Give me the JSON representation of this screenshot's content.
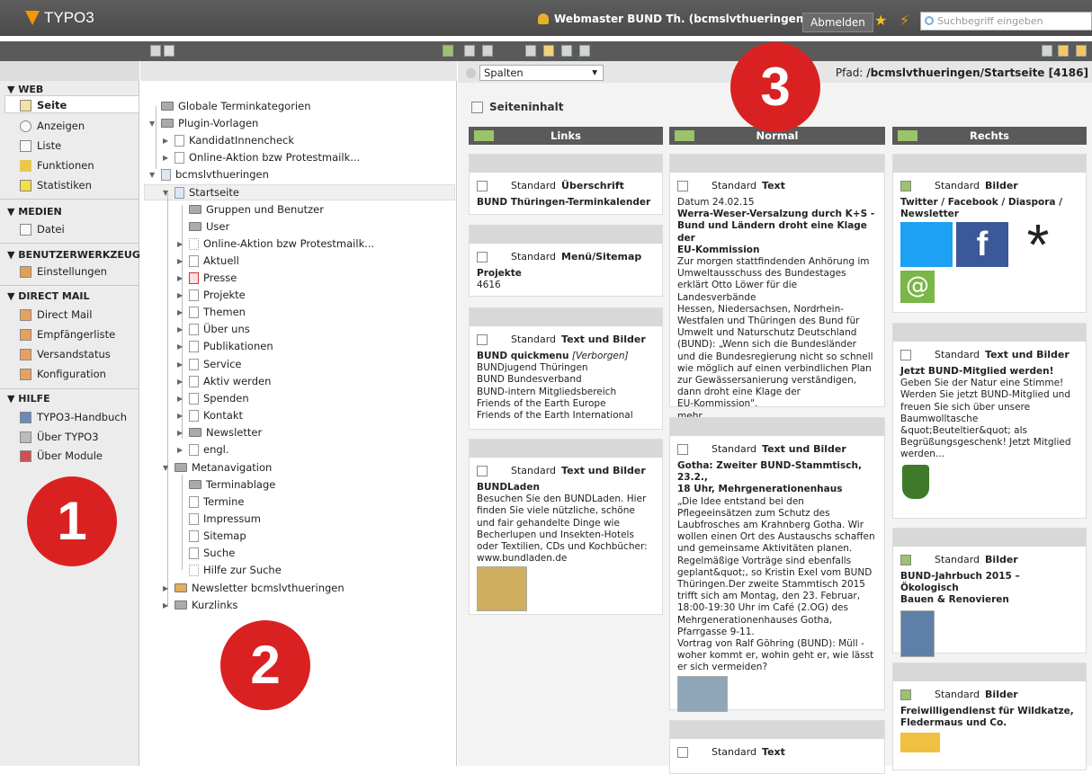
{
  "topbar": {
    "app_name": "TYPO3",
    "user": "Webmaster BUND Th. (bcmslvthueringen)",
    "logout": "Abmelden",
    "search_placeholder": "Suchbegriff eingeben"
  },
  "modules": {
    "web_label": "▼ WEB",
    "web_items": [
      "Seite",
      "Anzeigen",
      "Liste",
      "Funktionen",
      "Statistiken"
    ],
    "medien_label": "▼ MEDIEN",
    "medien_items": [
      "Datei"
    ],
    "tools_label": "▼ BENUTZERWERKZEUGE",
    "tools_items": [
      "Einstellungen"
    ],
    "dm_label": "▼ DIRECT MAIL",
    "dm_items": [
      "Direct Mail",
      "Empfängerliste",
      "Versandstatus",
      "Konfiguration"
    ],
    "help_label": "▼ HILFE",
    "help_items": [
      "TYPO3-Handbuch",
      "Über TYPO3",
      "Über Module"
    ]
  },
  "tree": [
    "Globale Terminkategorien",
    "Plugin-Vorlagen",
    "KandidatInnencheck",
    "Online-Aktion bzw Protestmailk...",
    "bcmslvthueringen",
    "Startseite",
    "Gruppen und Benutzer",
    "User",
    "Online-Aktion bzw Protestmailk...",
    "Aktuell",
    "Presse",
    "Projekte",
    "Themen",
    "Über uns",
    "Publikationen",
    "Service",
    "Aktiv werden",
    "Spenden",
    "Kontakt",
    "Newsletter",
    "engl.",
    "Metanavigation",
    "Terminablage",
    "Termine",
    "Impressum",
    "Sitemap",
    "Suche",
    "Hilfe zur Suche",
    "Newsletter bcmslvthueringen",
    "Kurzlinks"
  ],
  "main": {
    "view_select": "Spalten",
    "path_label": "Pfad:",
    "path_value": "/bcmslvthueringen/",
    "page": "Startseite [4186]",
    "section_title": "Seiteninhalt",
    "columns": [
      "Links",
      "Normal",
      "Rechts"
    ]
  },
  "cards": {
    "l1": {
      "std": "Standard",
      "type": "Überschrift",
      "title": "BUND Thüringen-Terminkalender",
      "body": ""
    },
    "l2": {
      "std": "Standard",
      "type": "Menü/Sitemap",
      "title": "Projekte",
      "body": "4616"
    },
    "l3": {
      "std": "Standard",
      "type": "Text und Bilder",
      "title": "BUND quickmenu",
      "hidden": "[Verborgen]",
      "body": "BUNDjugend Thüringen\nBUND Bundesverband\nBUND-intern Mitgliedsbereich\nFriends of the Earth Europe\nFriends of the Earth International"
    },
    "l4": {
      "std": "Standard",
      "type": "Text und Bilder",
      "title": "BUNDLaden",
      "body": "Besuchen Sie den BUNDLaden. Hier\nfinden Sie viele nützliche, schöne\nund fair gehandelte Dinge wie\nBecherlupen und Insekten-Hotels\noder Textilien, CDs und Kochbücher:\nwww.bundladen.de"
    },
    "n1": {
      "std": "Standard",
      "type": "Text",
      "title": "",
      "body": "Datum 24.02.15",
      "title2": "Werra-Weser-Versalzung durch K+S -\nBund und Ländern droht eine Klage der\nEU-Kommission",
      "body2": "Zur morgen stattfindenden Anhörung im\nUmweltausschuss des Bundestages\nerklärt Otto Löwer für die Landesverbände\nHessen, Niedersachsen, Nordrhein-\nWestfalen und Thüringen des Bund für\nUmwelt und Naturschutz Deutschland\n(BUND): „Wenn sich die Bundesländer\nund die Bundesregierung nicht so schnell\nwie möglich auf einen verbindlichen Plan\nzur Gewässersanierung verständigen,\ndann droht eine Klage der\nEU-Kommission\".\nmehr"
    },
    "n2": {
      "std": "Standard",
      "type": "Text und Bilder",
      "title": "Gotha: Zweiter BUND-Stammtisch, 23.2.,\n18 Uhr, Mehrgenerationenhaus",
      "body": "„Die Idee entstand bei den\nPflegeeinsätzen zum Schutz des\nLaubfrosches am Krahnberg Gotha. Wir\nwollen einen Ort des Austauschs schaffen\nund gemeinsame Aktivitäten planen.\nRegelmäßige Vorträge sind ebenfalls\ngeplant&quot;, so Kristin Exel vom BUND\nThüringen.Der zweite Stammtisch 2015\ntrifft sich am Montag, den 23. Februar,\n18:00-19:30 Uhr im Café (2.OG) des\nMehrgenerationenhauses Gotha,\nPfarrgasse 9-11.\nVortrag von Ralf Göhring (BUND): Müll -\nwoher kommt er, wohin geht er, wie lässt\ner sich vermeiden?"
    },
    "n3": {
      "std": "Standard",
      "type": "Text"
    },
    "r1": {
      "std": "Standard",
      "type": "Bilder",
      "title": "Twitter / Facebook / Diaspora /\nNewsletter"
    },
    "r2": {
      "std": "Standard",
      "type": "Text und Bilder",
      "title": "Jetzt BUND-Mitglied werden!",
      "body": "Geben Sie der Natur eine Stimme!\nWerden Sie jetzt BUND-Mitglied und\nfreuen Sie sich über unsere\nBaumwolltasche\n&quot;Beuteltier&quot; als\nBegrüßungsgeschenk! Jetzt Mitglied\nwerden..."
    },
    "r3": {
      "std": "Standard",
      "type": "Bilder",
      "title": "BUND-Jahrbuch 2015 – Ökologisch\nBauen & Renovieren"
    },
    "r4": {
      "std": "Standard",
      "type": "Bilder",
      "title": "Freiwilligendienst für Wildkatze,\nFledermaus und Co."
    }
  },
  "markers": [
    "1",
    "2",
    "3"
  ]
}
